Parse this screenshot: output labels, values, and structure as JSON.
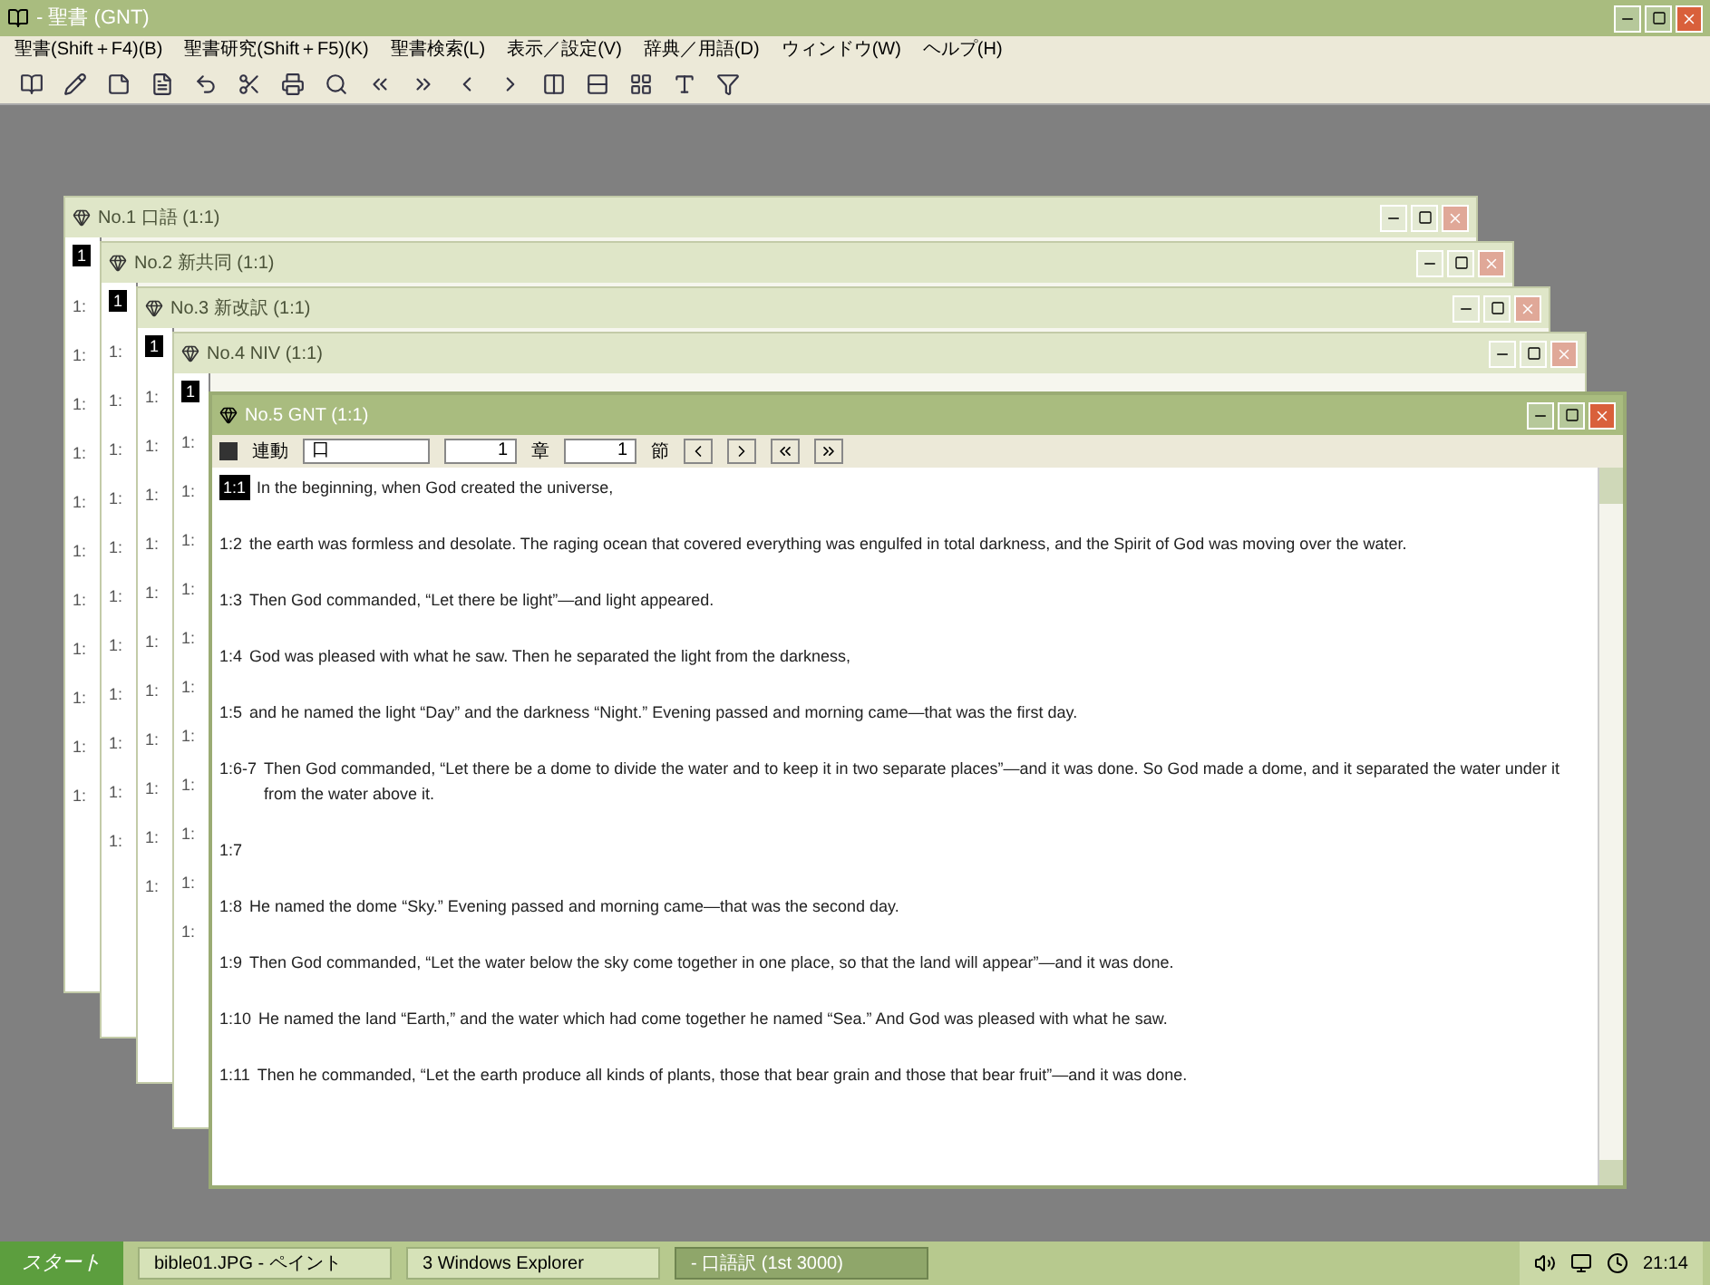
{
  "window": {
    "title": "- 聖書 (GNT)"
  },
  "menu": [
    "聖書(Shift＋F4)(B)",
    "聖書研究(Shift＋F5)(K)",
    "聖書検索(L)",
    "表示／設定(V)",
    "辞典／用語(D)",
    "ウィンドウ(W)",
    "ヘルプ(H)"
  ],
  "back_windows": [
    {
      "title": "No.1 口語 (1:1)",
      "marker": "1",
      "lines": [
        "1:",
        "1:",
        "1:",
        "1:",
        "1:",
        "1:",
        "1:",
        "1:",
        "1:",
        "1:",
        "1:"
      ]
    },
    {
      "title": "No.2 新共同 (1:1)",
      "marker": "1",
      "lines": [
        "1:",
        "1:",
        "1:",
        "1:",
        "1:",
        "1:",
        "1:",
        "1:",
        "1:",
        "1:",
        "1:"
      ]
    },
    {
      "title": "No.3 新改訳 (1:1)",
      "marker": "1",
      "lines": [
        "1:",
        "1:",
        "1:",
        "1:",
        "1:",
        "1:",
        "1:",
        "1:",
        "1:",
        "1:",
        "1:"
      ]
    },
    {
      "title": "No.4 NIV (1:1)",
      "marker": "1",
      "lines": [
        "1:",
        "1:",
        "1:",
        "1:",
        "1:",
        "1:",
        "1:",
        "1:",
        "1:",
        "1:",
        "1:"
      ]
    }
  ],
  "front_window": {
    "title": "No.5 GNT (1:1)",
    "sync": {
      "label": "連動",
      "checked": true
    },
    "version": "口",
    "chapter": "1",
    "chapter_label": "章",
    "verse": "1",
    "verse_label": "節",
    "verses": [
      {
        "number": "1:1",
        "text": "In the beginning, when God created the universe,",
        "selected": true
      },
      {
        "number": "1:2",
        "text": "the earth was formless and desolate. The raging ocean that covered everything was engulfed in total darkness, and the Spirit of God was moving over the water.",
        "selected": false
      },
      {
        "number": "1:3",
        "text": "Then God commanded, “Let there be light”—and light appeared.",
        "selected": false
      },
      {
        "number": "1:4",
        "text": "God was pleased with what he saw. Then he separated the light from the darkness,",
        "selected": false
      },
      {
        "number": "1:5",
        "text": "and he named the light “Day” and the darkness “Night.” Evening passed and morning came—that was the first day.",
        "selected": false
      },
      {
        "number": "1:6-7",
        "text": "Then God commanded, “Let there be a dome to divide the water and to keep it in two separate places”—and it was done. So God made a dome, and it separated the water under it from the water above it.",
        "selected": false
      },
      {
        "number": "1:7",
        "selected": false
      },
      {
        "number": "1:8",
        "text": "He named the dome “Sky.” Evening passed and morning came—that was the second day.",
        "selected": false
      },
      {
        "number": "1:9",
        "text": "Then God commanded, “Let the water below the sky come together in one place, so that the land will appear”—and it was done.",
        "selected": false
      },
      {
        "number": "1:10",
        "text": "He named the land “Earth,” and the water which had come together he named “Sea.” And God was pleased with what he saw.",
        "selected": false
      },
      {
        "number": "1:11",
        "text": "Then he commanded, “Let the earth produce all kinds of plants, those that bear grain and those that bear fruit”—and it was done.",
        "selected": false
      }
    ]
  },
  "taskbar": {
    "start": "スタート",
    "tasks": [
      {
        "label": "bible01.JPG - ペイント",
        "selected": false
      },
      {
        "label": "3 Windows Explorer",
        "selected": false
      },
      {
        "label": "- 口語訳 (1st 3000)",
        "selected": true
      }
    ],
    "clock": "21:14"
  }
}
